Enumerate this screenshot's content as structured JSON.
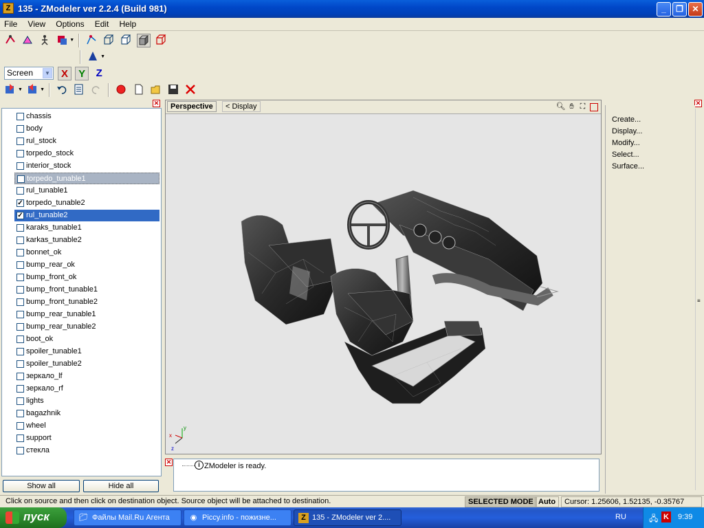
{
  "window": {
    "title": "135 - ZModeler ver 2.2.4 (Build 981)",
    "app_icon": "Z"
  },
  "menu": [
    "File",
    "View",
    "Options",
    "Edit",
    "Help"
  ],
  "toolbar": {
    "coord_select": "Screen",
    "axes": [
      "X",
      "Y",
      "Z"
    ],
    "axis_colors": {
      "X": "#c00000",
      "Y": "#008000",
      "Z": "#0000c0"
    }
  },
  "objects": [
    {
      "name": "chassis",
      "checked": false,
      "state": "normal"
    },
    {
      "name": "body",
      "checked": false,
      "state": "normal"
    },
    {
      "name": "rul_stock",
      "checked": false,
      "state": "normal"
    },
    {
      "name": "torpedo_stock",
      "checked": false,
      "state": "normal"
    },
    {
      "name": "interior_stock",
      "checked": false,
      "state": "normal"
    },
    {
      "name": "torpedo_tunable1",
      "checked": false,
      "state": "dim"
    },
    {
      "name": "rul_tunable1",
      "checked": false,
      "state": "normal"
    },
    {
      "name": "torpedo_tunable2",
      "checked": true,
      "state": "normal"
    },
    {
      "name": "rul_tunable2",
      "checked": true,
      "state": "selected"
    },
    {
      "name": "karaks_tunable1",
      "checked": false,
      "state": "normal"
    },
    {
      "name": "karkas_tunable2",
      "checked": false,
      "state": "normal"
    },
    {
      "name": "bonnet_ok",
      "checked": false,
      "state": "normal"
    },
    {
      "name": "bump_rear_ok",
      "checked": false,
      "state": "normal"
    },
    {
      "name": "bump_front_ok",
      "checked": false,
      "state": "normal"
    },
    {
      "name": "bump_front_tunable1",
      "checked": false,
      "state": "normal"
    },
    {
      "name": "bump_front_tunable2",
      "checked": false,
      "state": "normal"
    },
    {
      "name": "bump_rear_tunable1",
      "checked": false,
      "state": "normal"
    },
    {
      "name": "bump_rear_tunable2",
      "checked": false,
      "state": "normal"
    },
    {
      "name": "boot_ok",
      "checked": false,
      "state": "normal"
    },
    {
      "name": "spoiler_tunable1",
      "checked": false,
      "state": "normal"
    },
    {
      "name": "spoiler_tunable2",
      "checked": false,
      "state": "normal"
    },
    {
      "name": "зеркало_lf",
      "checked": false,
      "state": "normal"
    },
    {
      "name": "зеркало_rf",
      "checked": false,
      "state": "normal"
    },
    {
      "name": "lights",
      "checked": false,
      "state": "normal"
    },
    {
      "name": "bagazhnik",
      "checked": false,
      "state": "normal"
    },
    {
      "name": "wheel",
      "checked": false,
      "state": "normal"
    },
    {
      "name": "support",
      "checked": false,
      "state": "normal"
    },
    {
      "name": "стекла",
      "checked": false,
      "state": "normal"
    }
  ],
  "left_panel": {
    "show_all": "Show all",
    "hide_all": "Hide all"
  },
  "viewport": {
    "view_name": "Perspective",
    "display_tab": "< Display"
  },
  "log": {
    "message": "ZModeler is ready."
  },
  "right_panel": {
    "items": [
      "Create...",
      "Display...",
      "Modify...",
      "Select...",
      "Surface..."
    ]
  },
  "status": {
    "hint": "Click on source and then click on destination object. Source object will be attached to destination.",
    "mode": "SELECTED MODE",
    "auto": "Auto",
    "cursor": "Cursor: 1.25606, 1.52135, -0.35767"
  },
  "taskbar": {
    "start": "пуск",
    "tasks": [
      {
        "label": "Файлы Mail.Ru Агента",
        "icon": "folder-icon",
        "active": false
      },
      {
        "label": "Piccy.info - пожизне...",
        "icon": "browser-icon",
        "active": false
      },
      {
        "label": "135 - ZModeler ver 2....",
        "icon": "zmodeler-icon",
        "active": true
      }
    ],
    "language": "RU",
    "clock": "9:39"
  }
}
